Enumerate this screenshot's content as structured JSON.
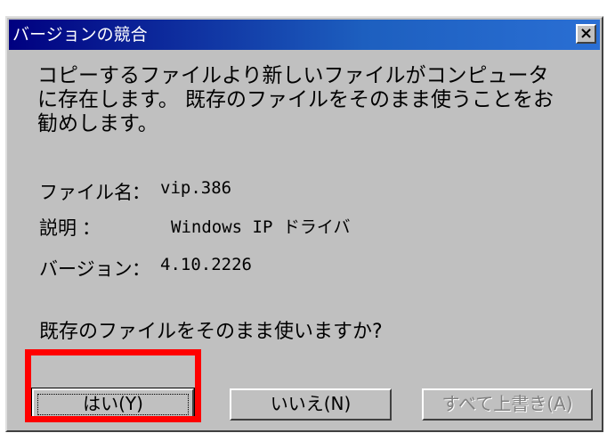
{
  "window": {
    "title": "バージョンの競合",
    "close_label": "×"
  },
  "message": {
    "line1": "コピーするファイルより新しいファイルがコンピュータ",
    "line2": "に存在します。 既存のファイルをそのまま使うことをお",
    "line3": "勧めします。"
  },
  "info": {
    "filename_label": "ファイル名",
    "filename_value": "vip.386",
    "description_label": "説明",
    "description_value": "Windows IP ドライバ",
    "version_label": "バージョン",
    "version_value": "4.10.2226",
    "colon": "："
  },
  "question": "既存のファイルをそのまま使いますか?",
  "buttons": {
    "yes": "はい(Y)",
    "no": "いいえ(N)",
    "overwrite_all": "すべて上書き(A)"
  }
}
